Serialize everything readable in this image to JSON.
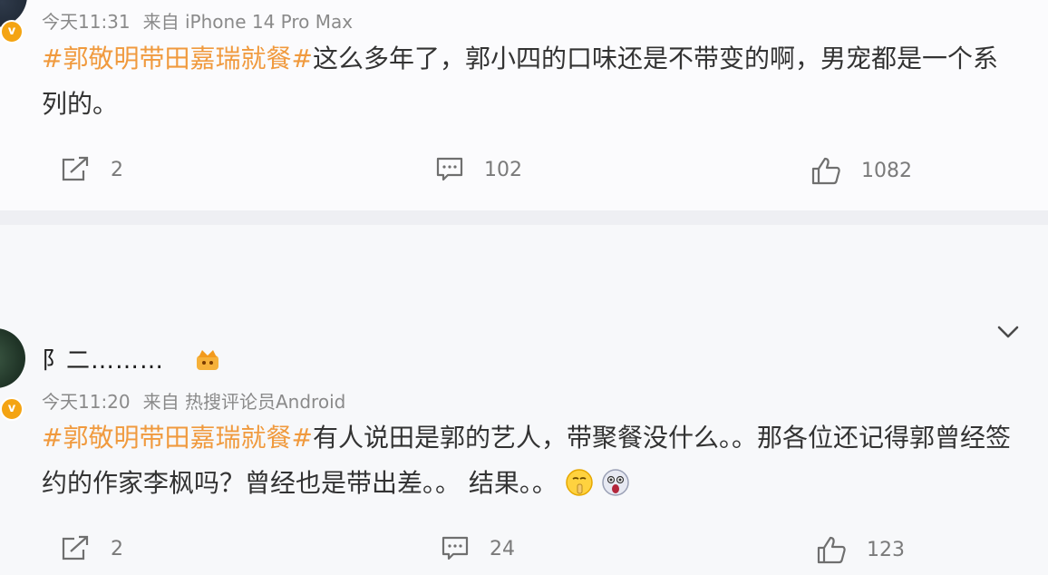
{
  "posts": [
    {
      "meta": {
        "time": "今天11:31",
        "source": "来自 iPhone 14 Pro Max"
      },
      "hashtag": "#郭敬明带田嘉瑞就餐#",
      "text": "这么多年了，郭小四的口味还是不带变的啊，男宠都是一个系列的。",
      "actions": {
        "reposts": "2",
        "comments": "102",
        "likes": "1082"
      }
    },
    {
      "username": "阝二………",
      "meta": {
        "time": "今天11:20",
        "source": "来自 热搜评论员Android"
      },
      "hashtag": "#郭敬明带田嘉瑞就餐#",
      "text": "有人说田是郭的艺人，带聚餐没什么。。那各位还记得郭曾经签约的作家李枫吗？曾经也是带出差。。 结果。。",
      "actions": {
        "reposts": "2",
        "comments": "24",
        "likes": "123"
      }
    }
  ],
  "colors": {
    "hashtag": "#f09a3e",
    "badge": "#f4a413",
    "meta": "#8a8a8a"
  },
  "icons": [
    "repost-icon",
    "comment-icon",
    "like-icon",
    "verified-badge-icon",
    "crown-icon",
    "chevron-down-icon",
    "shush-emoji-icon",
    "shocked-emoji-icon"
  ]
}
